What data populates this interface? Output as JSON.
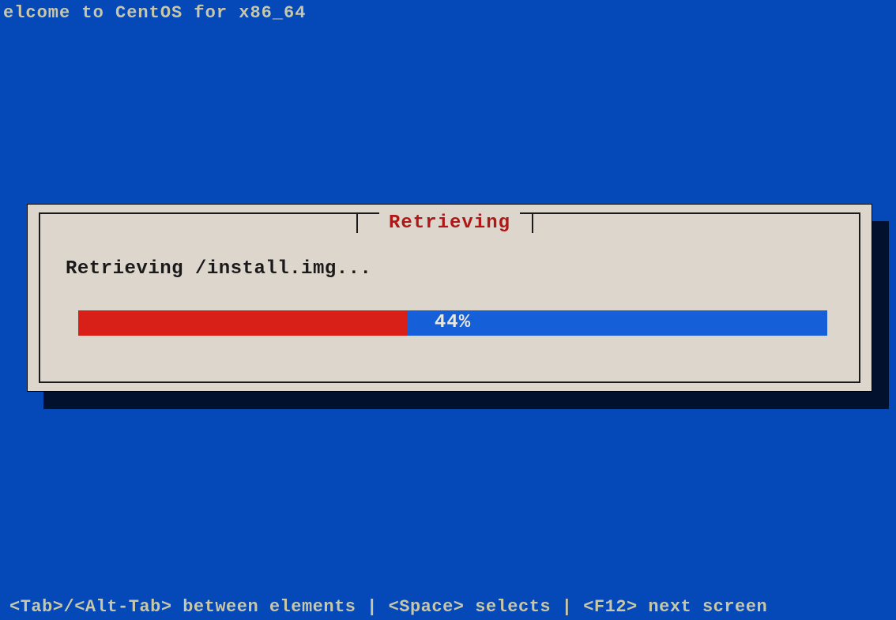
{
  "header": {
    "welcome_text": "elcome to CentOS for x86_64"
  },
  "dialog": {
    "title": "Retrieving",
    "status_text": "Retrieving /install.img...",
    "progress": {
      "percent": 44,
      "label": "44%",
      "fill_color": "#d82018",
      "track_color": "#1560d8"
    }
  },
  "footer": {
    "hint_text": "<Tab>/<Alt-Tab> between elements  | <Space> selects | <F12> next screen"
  },
  "colors": {
    "background": "#0548b8",
    "dialog_bg": "#dcd6cc",
    "title_color": "#b01818",
    "text_light": "#c8c8a8",
    "text_dark": "#1a1a1a"
  }
}
